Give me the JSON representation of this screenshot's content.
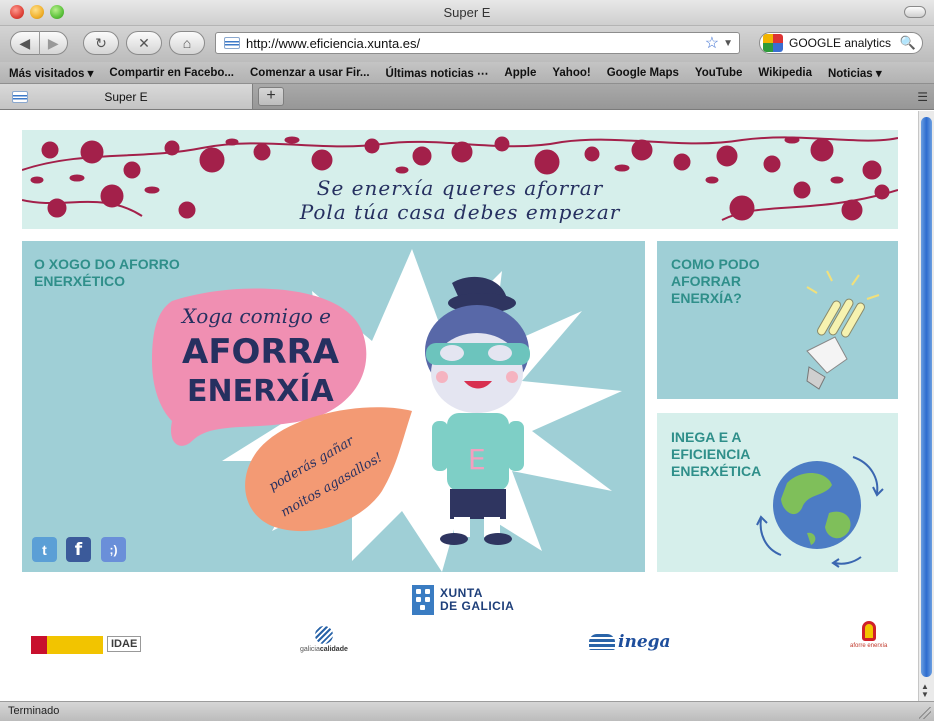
{
  "window": {
    "title": "Super E"
  },
  "toolbar": {
    "url": "http://www.eficiencia.xunta.es/",
    "search_value": "GOOGLE analytics"
  },
  "bookmarks": [
    "Más visitados ▾",
    "Compartir en Facebo...",
    "Comenzar a usar Fir...",
    "Últimas noticias ⋯",
    "Apple",
    "Yahoo!",
    "Google Maps",
    "YouTube",
    "Wikipedia",
    "Noticias ▾"
  ],
  "tab": {
    "label": "Super E"
  },
  "banner": {
    "line1": "Se enerxía queres aforrar",
    "line2": "Pola túa casa debes empezar"
  },
  "game": {
    "title_line1": "O XOGO DO AFORRO",
    "title_line2": "ENERXÉTICO",
    "bubble_small": "Xoga comigo e",
    "bubble_big1": "AFORRA",
    "bubble_big2": "ENERXÍA",
    "bubble2_line1": "poderás gañar",
    "bubble2_line2": "moitos agasallos!",
    "shirt_letter": "E"
  },
  "social": {
    "twitter": "t",
    "facebook": "f",
    "tuenti": ";)"
  },
  "side1": {
    "line1": "COMO PODO",
    "line2": "AFORRAR",
    "line3": "ENERXÍA?"
  },
  "side2": {
    "line1": "INEGA E A",
    "line2": "EFICIENCIA",
    "line3": "ENERXÉTICA"
  },
  "footer": {
    "xunta_line1": "XUNTA",
    "xunta_line2": "DE GALICIA",
    "idae": "IDAE",
    "galicia_calidade_a": "galicia",
    "galicia_calidade_b": "calidade",
    "inega": "inega",
    "aforre": "aforre enerxía"
  },
  "status": {
    "text": "Terminado"
  },
  "colors": {
    "panel_blue": "#9fcfd6",
    "panel_mint": "#d6efeb",
    "title_teal": "#2f8f8a",
    "flower_red": "#a3204a",
    "speech_pink": "#f08fb2",
    "speech_orange": "#f39a74"
  }
}
